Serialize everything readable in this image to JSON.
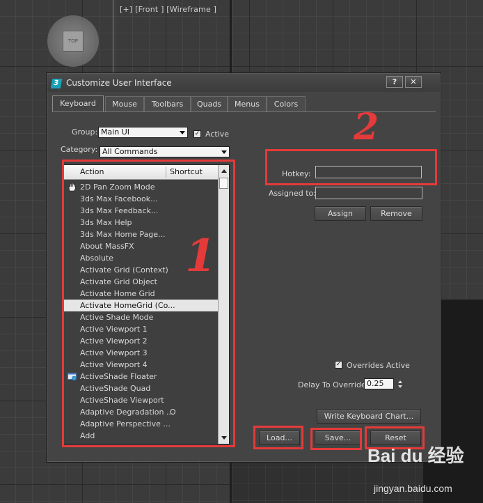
{
  "viewport": {
    "label": "[+] [Front ] [Wireframe ]",
    "viewcube_face": "TOP"
  },
  "dialog": {
    "title": "Customize User Interface",
    "help_button": "?",
    "close_button": "X",
    "tabs": [
      {
        "label": "Keyboard",
        "active": true
      },
      {
        "label": "Mouse",
        "active": false
      },
      {
        "label": "Toolbars",
        "active": false
      },
      {
        "label": "Quads",
        "active": false
      },
      {
        "label": "Menus",
        "active": false
      },
      {
        "label": "Colors",
        "active": false
      }
    ],
    "group_label": "Group:",
    "group_value": "Main UI",
    "active_label": "Active",
    "active_checked": true,
    "category_label": "Category:",
    "category_value": "All Commands",
    "list": {
      "col_action": "Action",
      "col_shortcut": "Shortcut",
      "rows": [
        {
          "action": "2D Pan Zoom Mode",
          "shortcut": "",
          "icon": "hand-icon"
        },
        {
          "action": "3ds Max Facebook...",
          "shortcut": ""
        },
        {
          "action": "3ds Max Feedback...",
          "shortcut": ""
        },
        {
          "action": "3ds Max Help",
          "shortcut": ""
        },
        {
          "action": "3ds Max Home Page...",
          "shortcut": ""
        },
        {
          "action": "About MassFX",
          "shortcut": ""
        },
        {
          "action": "Absolute",
          "shortcut": ""
        },
        {
          "action": "Activate Grid (Context)",
          "shortcut": ""
        },
        {
          "action": "Activate Grid Object",
          "shortcut": ""
        },
        {
          "action": "Activate Home Grid",
          "shortcut": ""
        },
        {
          "action": "Activate HomeGrid (Co...",
          "shortcut": "",
          "selected": true
        },
        {
          "action": "Active Shade Mode",
          "shortcut": ""
        },
        {
          "action": "Active Viewport 1",
          "shortcut": ""
        },
        {
          "action": "Active Viewport 2",
          "shortcut": ""
        },
        {
          "action": "Active Viewport 3",
          "shortcut": ""
        },
        {
          "action": "Active Viewport 4",
          "shortcut": ""
        },
        {
          "action": "ActiveShade Floater",
          "shortcut": "",
          "icon": "activeshade-icon"
        },
        {
          "action": "ActiveShade Quad",
          "shortcut": ""
        },
        {
          "action": "ActiveShade Viewport",
          "shortcut": ""
        },
        {
          "action": "Adaptive Degradation ...",
          "shortcut": "O"
        },
        {
          "action": "Adaptive Perspective ...",
          "shortcut": ""
        },
        {
          "action": "Add",
          "shortcut": ""
        }
      ]
    },
    "hotkey_label": "Hotkey:",
    "hotkey_value": "",
    "assigned_label": "Assigned to:",
    "assigned_value": "",
    "assign_button": "Assign",
    "remove_button": "Remove",
    "overrides_label": "Overrides Active",
    "overrides_checked": true,
    "delay_label": "Delay To Override:",
    "delay_value": "0.25",
    "write_chart_button": "Write Keyboard Chart...",
    "load_button": "Load...",
    "save_button": "Save...",
    "reset_button": "Reset"
  },
  "annotations": {
    "mark_1": "1",
    "mark_2": "2",
    "color": "#e53a3a"
  },
  "watermark": {
    "logo": "Bai du 经验",
    "url": "jingyan.baidu.com"
  }
}
